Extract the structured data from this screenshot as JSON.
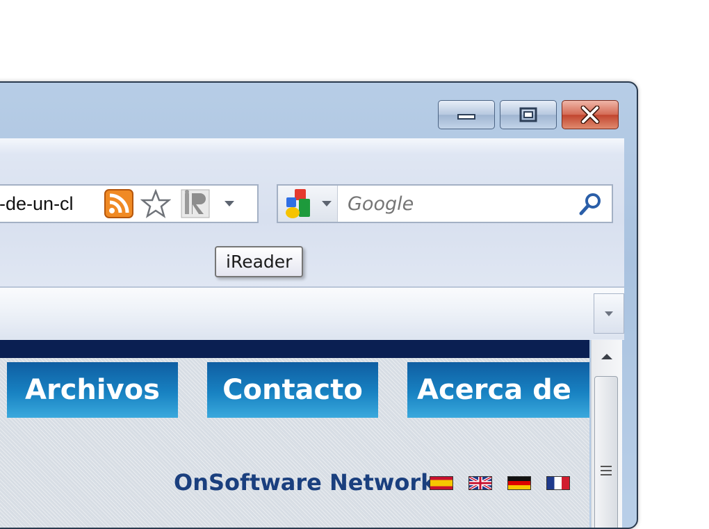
{
  "address_bar": {
    "url_fragment": "o-de-un-cl"
  },
  "search": {
    "placeholder": "Google"
  },
  "tooltip": {
    "text": "iReader"
  },
  "nav_tabs": [
    {
      "label": "Archivos"
    },
    {
      "label": "Contacto"
    },
    {
      "label": "Acerca de"
    }
  ],
  "site": {
    "network_label": "OnSoftware Network"
  },
  "flags": [
    "spanish-flag",
    "uk-flag",
    "german-flag",
    "french-flag"
  ],
  "colors": {
    "nav_tab": "#1882c2",
    "nav_bar": "#0a1f52",
    "network_text": "#1a3f7e",
    "rss": "#f08a24",
    "close_button": "#c1452f"
  }
}
